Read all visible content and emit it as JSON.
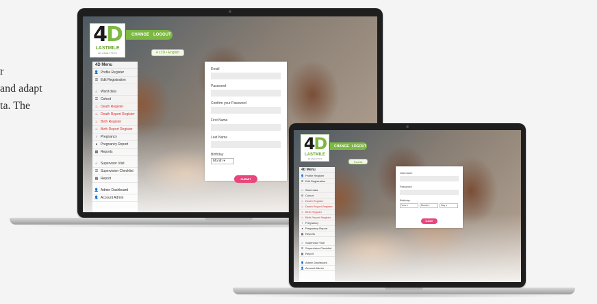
{
  "intro": {
    "line1": "r",
    "line2": "and adapt",
    "line3": "ta.  The"
  },
  "app": {
    "logo_mark": "4",
    "logo_mark_accent": "D",
    "logo_brand": "LASTMILE",
    "logo_tag": "4D ANALYTICS",
    "nav_items": [
      "CHANGE",
      "LOGOUT"
    ],
    "lang_large": "4 LTD • English",
    "lang_small": "Swahili",
    "menu_title": "4D Menu",
    "menu_groups": [
      [
        "Profile Register",
        "Edit Registration"
      ],
      [
        "Ward data",
        "Cohort",
        "Death Register",
        "Death Report Register",
        "Birth Register",
        "Birth Report Register",
        "Pregnancy",
        "Pregnancy Report",
        "Reports"
      ],
      [
        "Supervisor Visit",
        "Supervision Checklist",
        "Report"
      ],
      [
        "Admin Dashboard",
        "Account Admin"
      ]
    ]
  },
  "form_large": {
    "fields": [
      "Email",
      "Password",
      "Confirm your Password",
      "First Name",
      "Last Name"
    ],
    "dob_label": "Birthday",
    "dob_placeholder": "Month",
    "submit": "SUBMIT"
  },
  "form_small": {
    "fields": [
      "Username",
      "Password"
    ],
    "dob_label": "Birthday",
    "dob_selects": [
      "Year",
      "Month",
      "Day"
    ],
    "submit": "SUBMIT"
  }
}
